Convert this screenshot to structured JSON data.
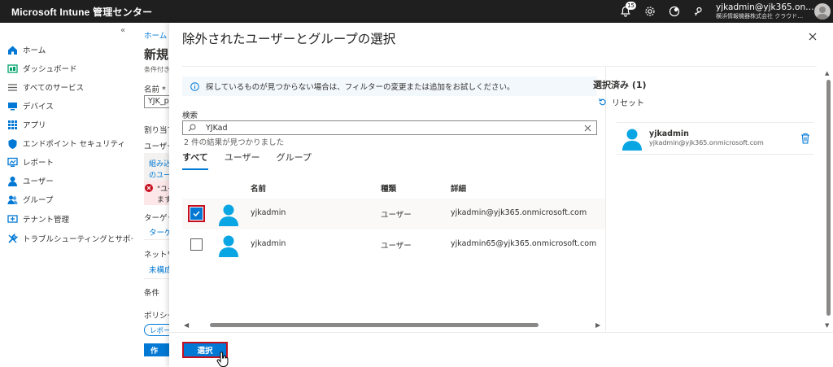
{
  "topbar": {
    "brand": "Microsoft Intune 管理センター",
    "notification_count": "15",
    "user": "yjkadmin@yjk365.on…",
    "tenant": "横浜情報機器株式会社 クラウド…"
  },
  "nav": {
    "collapse": "«",
    "items": [
      {
        "label": "ホーム",
        "icon": "home-icon",
        "color": "#0078d4"
      },
      {
        "label": "ダッシュボード",
        "icon": "dashboard-icon",
        "color": "#00a36c"
      },
      {
        "label": "すべてのサービス",
        "icon": "list-icon",
        "color": "#605e5c"
      },
      {
        "label": "デバイス",
        "icon": "device-icon",
        "color": "#0078d4"
      },
      {
        "label": "アプリ",
        "icon": "apps-icon",
        "color": "#0078d4"
      },
      {
        "label": "エンドポイント セキュリティ",
        "icon": "shield-icon",
        "color": "#0078d4"
      },
      {
        "label": "レポート",
        "icon": "report-icon",
        "color": "#0078d4"
      },
      {
        "label": "ユーザー",
        "icon": "user-icon",
        "color": "#0078d4"
      },
      {
        "label": "グループ",
        "icon": "group-icon",
        "color": "#0078d4"
      },
      {
        "label": "テナント管理",
        "icon": "tenant-icon",
        "color": "#0078d4"
      },
      {
        "label": "トラブルシューティングとサポート",
        "icon": "wrench-icon",
        "color": "#0078d4"
      }
    ]
  },
  "bgpage": {
    "breadcrumb": "ホーム >",
    "title": "新規",
    "subtitle": "条件付き",
    "name_label": "名前 *",
    "name_value": "YJK_p",
    "assign_label": "割り当て",
    "users_label": "ユーザー",
    "combo_line1": "組み込",
    "combo_line2": "のユー",
    "error_line1": "\"ユー",
    "error_line2": "ます",
    "target_label": "ターゲット",
    "target_link": "ターゲ",
    "network_label": "ネットワー",
    "network_link": "未構成",
    "conditions_label": "条件",
    "policy_label": "ポリシー",
    "toggle_label": "レポー",
    "create_btn": "作"
  },
  "dialog": {
    "title": "除外されたユーザーとグループの選択",
    "info": "探しているものが見つからない場合は、フィルターの変更または追加をお試しください。",
    "search_label": "検索",
    "search_value": "YJKad",
    "result_count": "2 件の結果が見つかりました",
    "tabs": [
      "すべて",
      "ユーザー",
      "グループ"
    ],
    "columns": {
      "name": "名前",
      "type": "種類",
      "detail": "詳細"
    },
    "rows": [
      {
        "name": "yjkadmin",
        "type": "ユーザー",
        "detail": "yjkadmin@yjk365.onmicrosoft.com",
        "checked": true
      },
      {
        "name": "yjkadmin",
        "type": "ユーザー",
        "detail": "yjkadmin65@yjk365.onmicrosoft.com",
        "checked": false
      }
    ],
    "selected_title": "選択済み (1)",
    "reset_label": "リセット",
    "selected_item": {
      "name": "yjkadmin",
      "email": "yjkadmin@yjk365.onmicrosoft.com"
    },
    "select_button": "選択"
  },
  "colors": {
    "accent": "#0078d4",
    "error": "#c50f1f"
  }
}
